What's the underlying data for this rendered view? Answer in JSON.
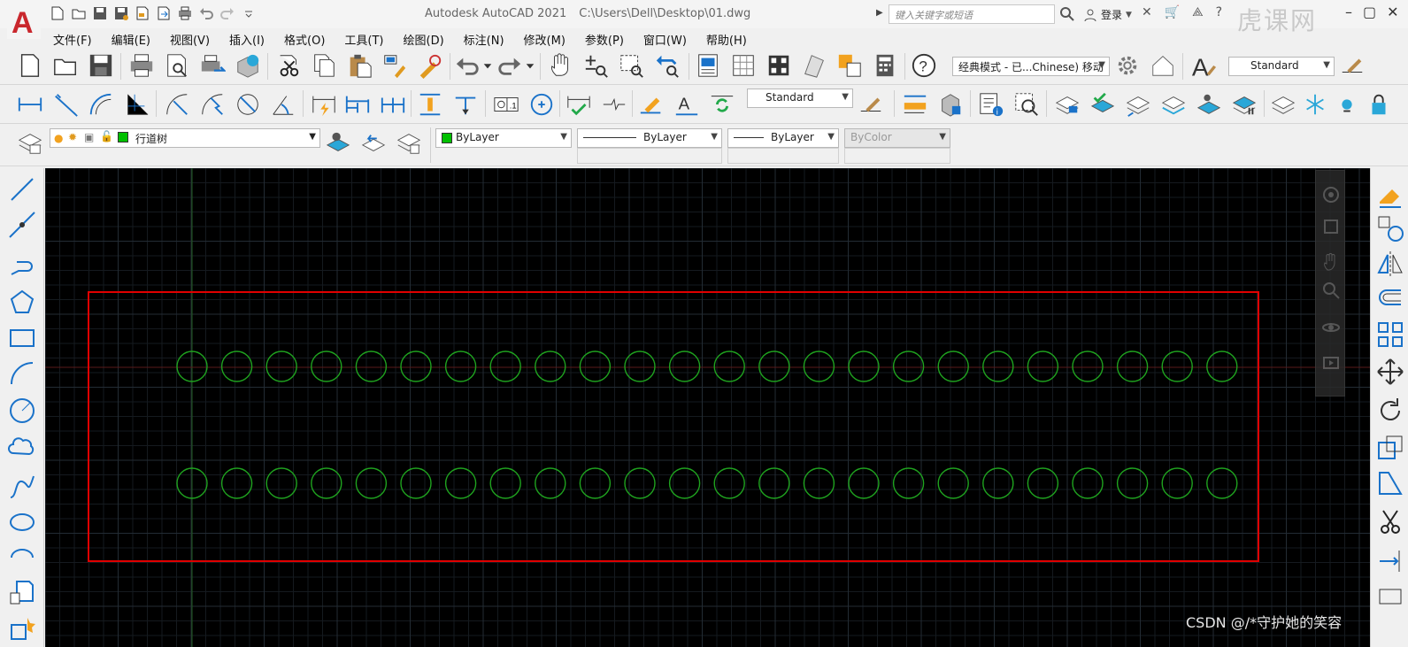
{
  "titlebar": {
    "app_title": "Autodesk AutoCAD 2021",
    "file_path": "C:\\Users\\Dell\\Desktop\\01.dwg",
    "search_placeholder": "键入关键字或短语",
    "login_label": "登录",
    "brand_watermark": "虎课网"
  },
  "menus": [
    "文件(F)",
    "编辑(E)",
    "视图(V)",
    "插入(I)",
    "格式(O)",
    "工具(T)",
    "绘图(D)",
    "标注(N)",
    "修改(M)",
    "参数(P)",
    "窗口(W)",
    "帮助(H)"
  ],
  "toolbar1": {
    "workspace": "经典模式 - 已...Chinese) 移动",
    "text_style": "Standard"
  },
  "toolbar2": {
    "dim_style": "Standard"
  },
  "toolbar3": {
    "layer": "行道树",
    "layer_color": "#00c000",
    "color": "ByLayer",
    "linetype": "ByLayer",
    "lineweight": "ByLayer",
    "plotstyle": "ByColor"
  },
  "drawing": {
    "boundary_color": "#e00000",
    "circle_color": "#1fa31f"
  },
  "watermark": "CSDN @/*守护她的笑容"
}
